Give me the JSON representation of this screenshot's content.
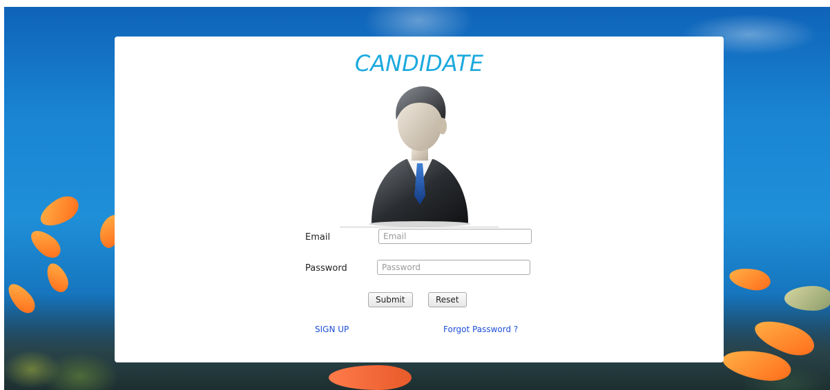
{
  "card": {
    "title": "CANDIDATE",
    "avatar_icon": "businessman-avatar-icon"
  },
  "form": {
    "email_label": "Email",
    "email_placeholder": "Email",
    "email_value": "",
    "password_label": "Password",
    "password_placeholder": "Password",
    "password_value": "",
    "submit_label": "Submit",
    "reset_label": "Reset"
  },
  "links": {
    "signup_label": "SIGN UP",
    "forgot_label": "Forgot Password ?"
  },
  "colors": {
    "title": "#1ba9de",
    "link": "#1e4fd6",
    "card_background": "#ffffff",
    "page_background": "#1a86d4"
  }
}
